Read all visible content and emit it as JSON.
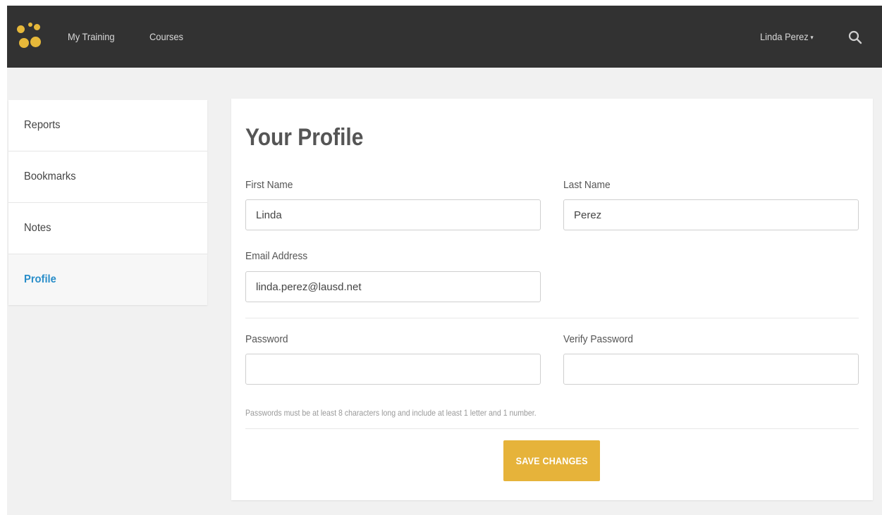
{
  "nav": {
    "links": [
      "My Training",
      "Courses"
    ],
    "user_name": "Linda Perez",
    "user_caret": "▾",
    "search_icon": "search-icon"
  },
  "sidebar": {
    "items": [
      {
        "label": "Reports"
      },
      {
        "label": "Bookmarks"
      },
      {
        "label": "Notes"
      },
      {
        "label": "Profile",
        "active": true
      }
    ]
  },
  "profile": {
    "title": "Your Profile",
    "first_name_label": "First Name",
    "first_name_value": "Linda",
    "last_name_label": "Last Name",
    "last_name_value": "Perez",
    "email_label": "Email Address",
    "email_value": "linda.perez@lausd.net",
    "password_label": "Password",
    "password_value": "",
    "verify_password_label": "Verify Password",
    "verify_password_value": "",
    "password_hint": "Passwords must be at least 8 characters long and include at least 1 letter and 1 number.",
    "save_label": "SAVE CHANGES"
  },
  "colors": {
    "topbar": "#323232",
    "accent": "#e6b33a",
    "active_link": "#2a8ec9"
  }
}
